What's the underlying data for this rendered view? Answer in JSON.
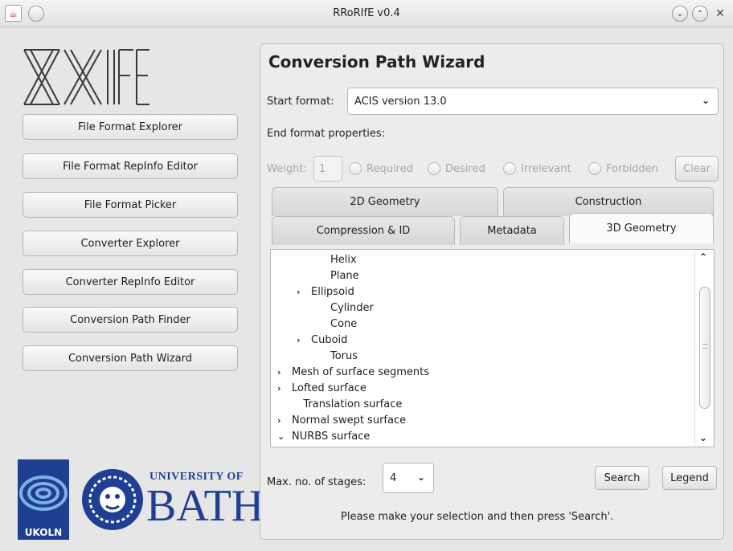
{
  "window": {
    "title": "RRoRIfE v0.4",
    "app_icon": "java-cup-icon",
    "icons": [
      "minimize-icon",
      "maximize-icon",
      "close-icon"
    ]
  },
  "sidebar": {
    "logo_text": "RRoRIfE",
    "buttons": [
      {
        "label": "File Format Explorer"
      },
      {
        "label": "File Format RepInfo Editor"
      },
      {
        "label": "File Format Picker"
      },
      {
        "label": "Converter Explorer"
      },
      {
        "label": "Converter RepInfo Editor"
      },
      {
        "label": "Conversion Path Finder"
      },
      {
        "label": "Conversion Path Wizard"
      }
    ],
    "ukoln": "UKOLN",
    "university_of": "UNIVERSITY OF",
    "bath": "BATH"
  },
  "wizard": {
    "title": "Conversion Path Wizard",
    "start_format_label": "Start format:",
    "start_format_value": "ACIS version 13.0",
    "end_props_label": "End format properties:",
    "weight_label": "Weight:",
    "weight_value": "1",
    "radios": [
      "Required",
      "Desired",
      "Irrelevant",
      "Forbidden"
    ],
    "clear_label": "Clear",
    "tabs_back": [
      "2D Geometry",
      "Construction"
    ],
    "tabs_front": [
      "Compression & ID",
      "Metadata",
      "3D Geometry"
    ],
    "active_tab": "3D Geometry",
    "tree": [
      {
        "label": "Helix",
        "level": 2,
        "expandable": false
      },
      {
        "label": "Plane",
        "level": 2,
        "expandable": false
      },
      {
        "label": "Ellipsoid",
        "level": 1,
        "expandable": true
      },
      {
        "label": "Cylinder",
        "level": 2,
        "expandable": false
      },
      {
        "label": "Cone",
        "level": 2,
        "expandable": false
      },
      {
        "label": "Cuboid",
        "level": 1,
        "expandable": true
      },
      {
        "label": "Torus",
        "level": 2,
        "expandable": false
      },
      {
        "label": "Mesh of surface segments",
        "level": 0,
        "expandable": true
      },
      {
        "label": "Lofted surface",
        "level": 0,
        "expandable": true
      },
      {
        "label": "Translation surface",
        "level": 0.6,
        "expandable": false
      },
      {
        "label": "Normal swept surface",
        "level": 0,
        "expandable": true
      },
      {
        "label": "NURBS surface",
        "level": 0,
        "expandable": true,
        "expanded": true
      }
    ],
    "max_stages_label": "Max. no. of stages:",
    "max_stages_value": "4",
    "search_label": "Search",
    "legend_label": "Legend",
    "status_text": "Please make your selection and then press 'Search'."
  }
}
